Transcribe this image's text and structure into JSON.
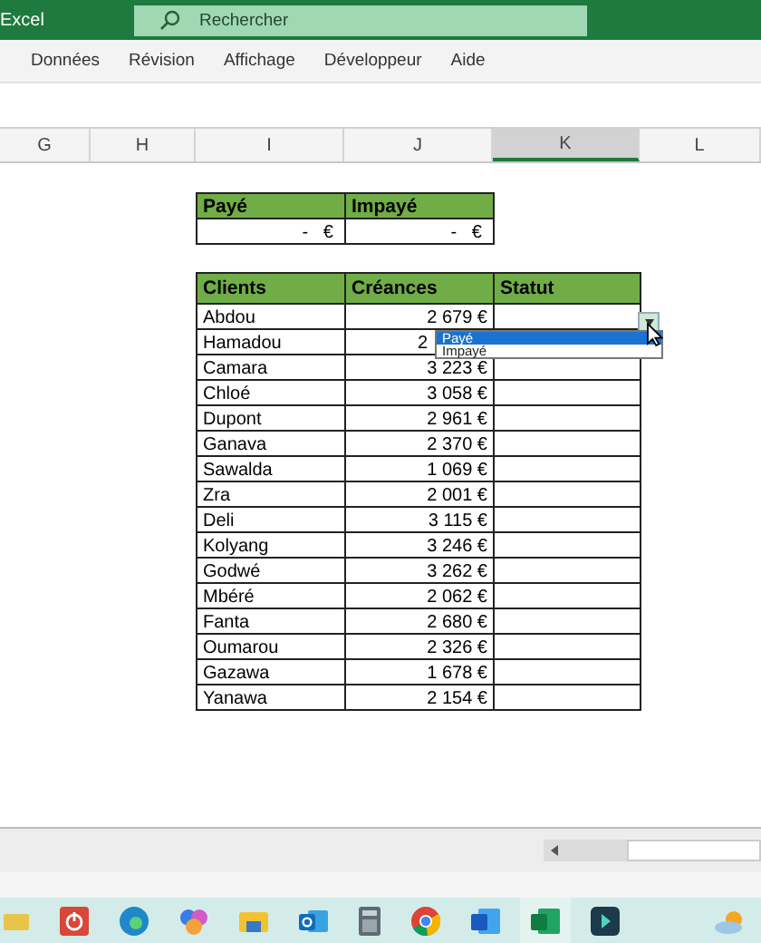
{
  "window": {
    "title": "Excel"
  },
  "search": {
    "placeholder": "Rechercher"
  },
  "menu": [
    "Données",
    "Révision",
    "Affichage",
    "Développeur",
    "Aide"
  ],
  "column_headers": [
    {
      "label": "G",
      "selected": false
    },
    {
      "label": "H",
      "selected": false
    },
    {
      "label": "I",
      "selected": false
    },
    {
      "label": "J",
      "selected": false
    },
    {
      "label": "K",
      "selected": true
    },
    {
      "label": "L",
      "selected": false
    }
  ],
  "summary": {
    "columns": [
      "Payé",
      "Impayé"
    ],
    "values": [
      "-   €",
      "-   €"
    ]
  },
  "table": {
    "columns": [
      "Clients",
      "Créances",
      "Statut"
    ],
    "rows": [
      {
        "client": "Abdou",
        "amount": "2 679 €"
      },
      {
        "client": "Hamadou",
        "amount": "2",
        "covered": true
      },
      {
        "client": "Camara",
        "amount": "3 223 €"
      },
      {
        "client": "Chloé",
        "amount": "3 058 €"
      },
      {
        "client": "Dupont",
        "amount": "2 961 €"
      },
      {
        "client": "Ganava",
        "amount": "2 370 €"
      },
      {
        "client": "Sawalda",
        "amount": "1 069 €"
      },
      {
        "client": "Zra",
        "amount": "2 001 €"
      },
      {
        "client": "Deli",
        "amount": "3 115 €"
      },
      {
        "client": "Kolyang",
        "amount": "3 246 €"
      },
      {
        "client": "Godwé",
        "amount": "3 262 €"
      },
      {
        "client": "Mbéré",
        "amount": "2 062 €"
      },
      {
        "client": "Fanta",
        "amount": "2 680 €"
      },
      {
        "client": "Oumarou",
        "amount": "2 326 €"
      },
      {
        "client": "Gazawa",
        "amount": "1 678 €"
      },
      {
        "client": "Yanawa",
        "amount": "2 154 €"
      }
    ]
  },
  "dropdown": {
    "options": [
      {
        "label": "Payé",
        "selected": true
      },
      {
        "label": "Impayé",
        "selected": false
      }
    ]
  }
}
